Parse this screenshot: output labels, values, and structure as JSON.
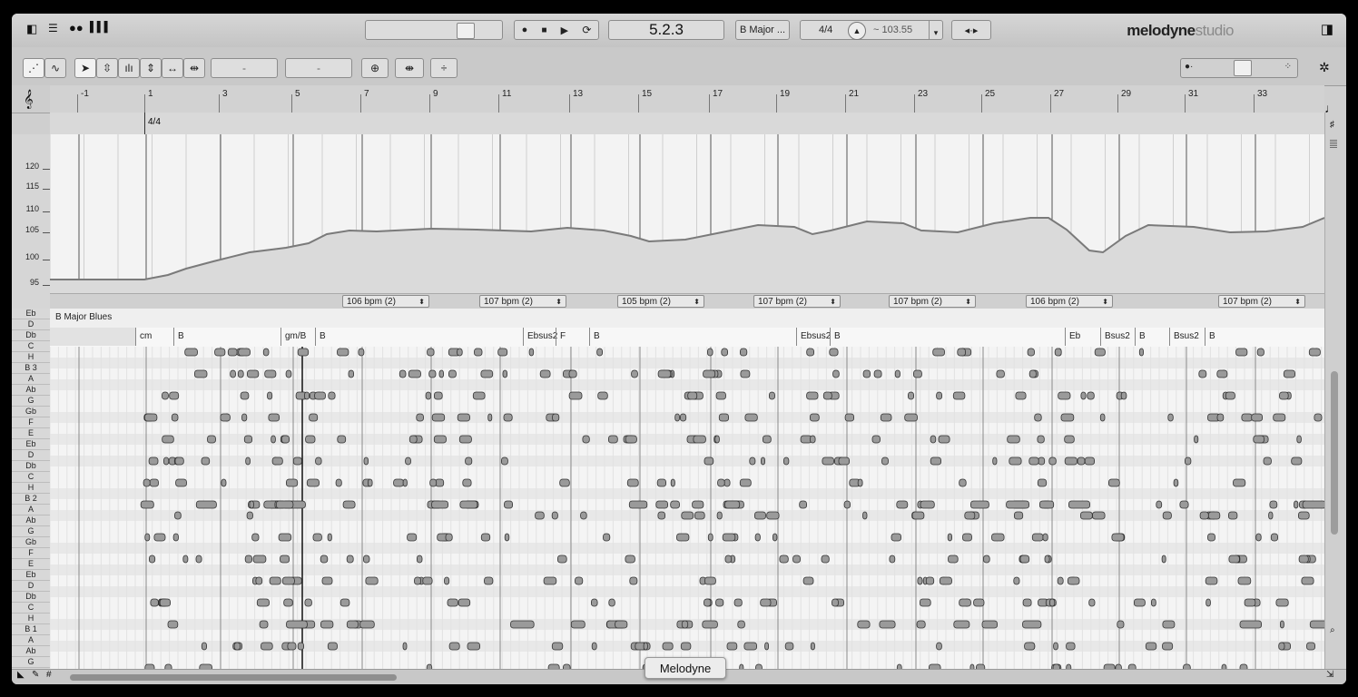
{
  "transport": {
    "counter": "5.2.3",
    "key": "B Major ...",
    "time_signature": "4/4",
    "tempo": "~ 103.55"
  },
  "app": {
    "brand": "melodyne",
    "edition": "studio"
  },
  "toolbar": {
    "field1": "-",
    "field2": "-"
  },
  "ruler": {
    "bars": [
      "-1",
      "1",
      "3",
      "5",
      "7",
      "9",
      "11",
      "13",
      "15",
      "17",
      "19",
      "21",
      "23",
      "25",
      "27",
      "29",
      "31",
      "33"
    ]
  },
  "signature_lane": {
    "value": "4/4"
  },
  "tempo_axis": {
    "labels": [
      "120",
      "115",
      "110",
      "105",
      "100",
      "95"
    ]
  },
  "tempo_lane": {
    "segments": [
      "106 bpm  (2)",
      "107 bpm  (2)",
      "105 bpm  (2)",
      "107 bpm  (2)",
      "107 bpm  (2)",
      "106 bpm  (2)",
      "107 bpm  (2)"
    ]
  },
  "scale": {
    "name": "B Major Blues"
  },
  "chords": [
    "cm",
    "B",
    "gm/B",
    "B",
    "Ebsus2",
    "F",
    "B",
    "Ebsus2",
    "B",
    "Eb",
    "Bsus2",
    "B",
    "Bsus2",
    "B"
  ],
  "pitch_names": [
    "Eb",
    "D",
    "Db",
    "C",
    "H",
    "B 3",
    "A",
    "Ab",
    "G",
    "Gb",
    "F",
    "E",
    "Eb",
    "D",
    "Db",
    "C",
    "H",
    "B 2",
    "A",
    "Ab",
    "G",
    "Gb",
    "F",
    "E",
    "Eb",
    "D",
    "Db",
    "C",
    "H",
    "B 1",
    "A",
    "Ab",
    "G"
  ],
  "tooltip": {
    "label": "Melodyne"
  }
}
